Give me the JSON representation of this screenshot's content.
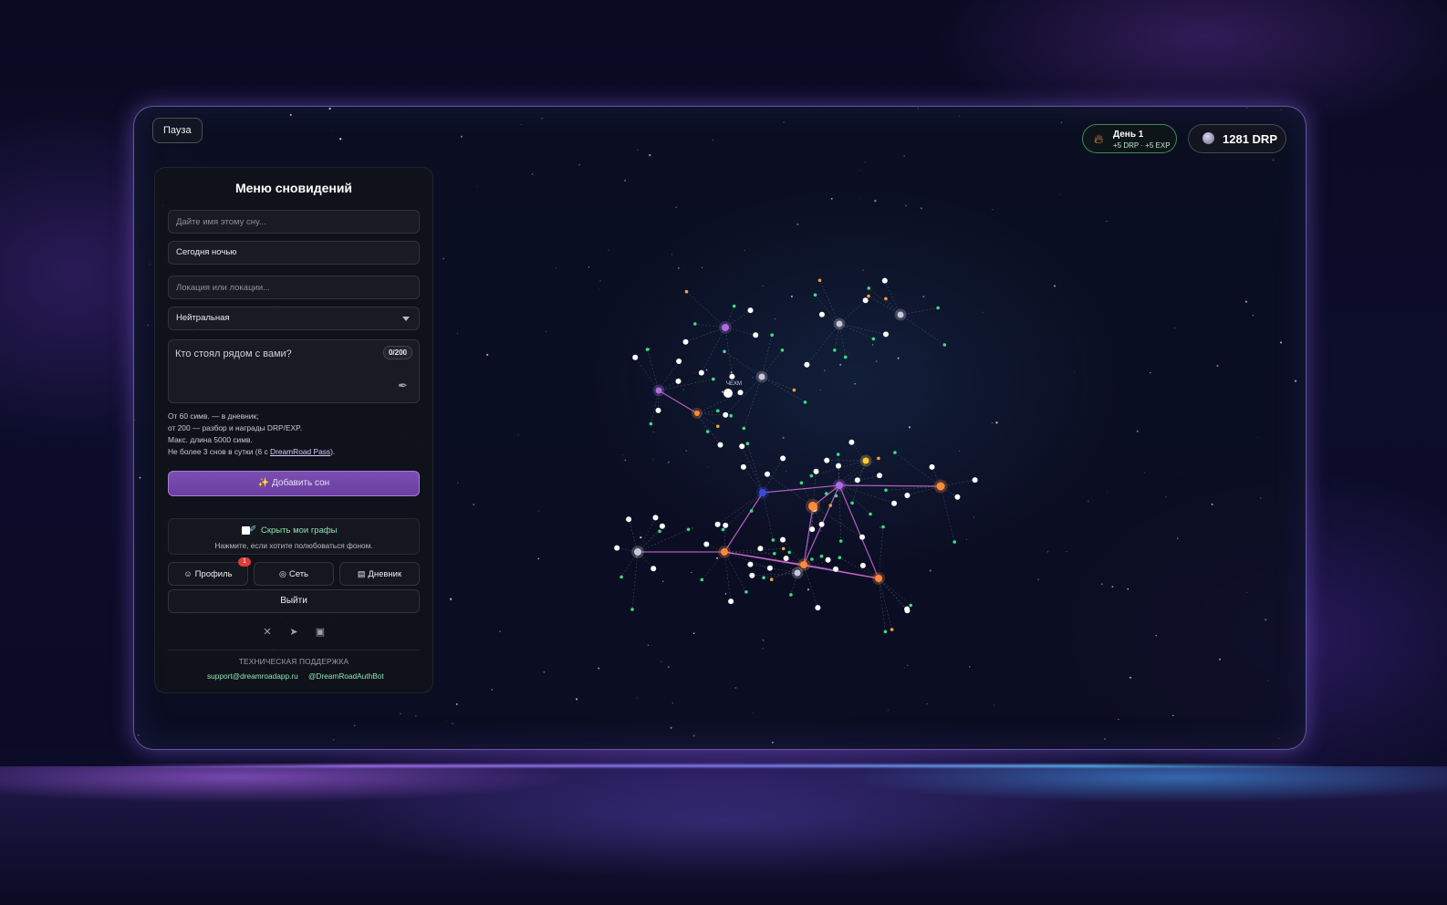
{
  "top": {
    "pause_label": "Пауза",
    "streak": {
      "title": "День 1",
      "reward": "+5 DRP · +5 EXP",
      "icon": "fire-icon"
    },
    "balance": {
      "value": "1281",
      "currency": "DRP",
      "icon": "coin-icon"
    }
  },
  "menu": {
    "title": "Меню сновидений",
    "name_placeholder": "Дайте имя этому сну...",
    "time_value": "Сегодня ночью",
    "location_placeholder": "Локация или локации...",
    "mood_value": "Нейтральная",
    "story_placeholder": "Кто стоял рядом с вами?",
    "char_count": "0/200",
    "hints": [
      "От 60 симв. — в дневник;",
      "от 200 — разбор и награды DRP/EXP.",
      "Макс. длина 5000 симв."
    ],
    "limit_hint_pre": "Не более 3 снов в сутки (6 с ",
    "limit_hint_link": "DreamRoad Pass",
    "limit_hint_post": ").",
    "add_button": "✨ Добавить сон",
    "hide_graphs_label": "Скрыть мои графы",
    "hide_graphs_hint": "Нажмите, если хотите полюбоваться фоном.",
    "nav": [
      {
        "label": "Профиль",
        "icon": "user-icon",
        "badge": "1"
      },
      {
        "label": "Сеть",
        "icon": "globe-icon"
      },
      {
        "label": "Дневник",
        "icon": "book-icon"
      }
    ],
    "logout": "Выйти",
    "socials": [
      "x-icon",
      "telegram-icon",
      "vk-icon"
    ],
    "support_title": "ТЕХНИЧЕСКАЯ ПОДДЕРЖКА",
    "support_email": "support@dreamroadapp.ru",
    "support_bot": "@DreamRoadAuthBot"
  },
  "graph": {
    "node_label": "ЧЕХМ",
    "colors": {
      "hub_purple": "#b06ce0",
      "hub_orange": "#ff8a3a",
      "hub_gray": "#c8c8d8",
      "edge": "#d06ad8",
      "leaf_green": "#3ddc84",
      "leaf_white": "#ffffff"
    }
  }
}
